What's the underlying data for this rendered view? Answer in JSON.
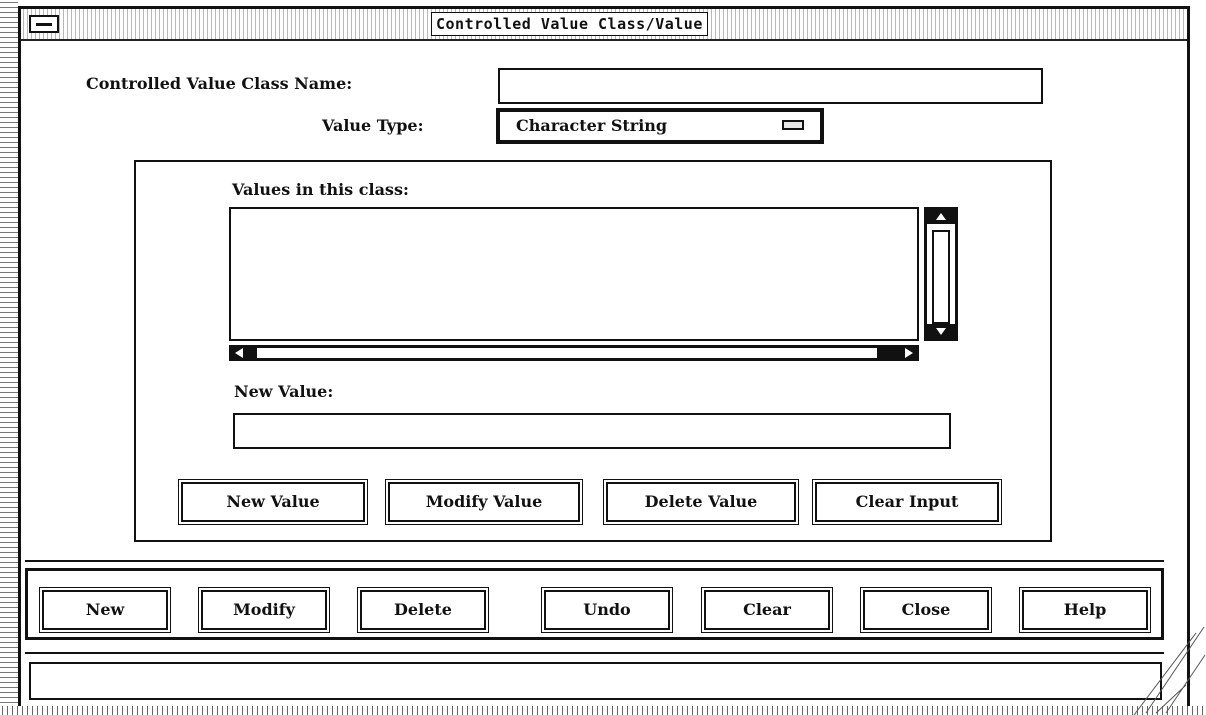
{
  "window": {
    "title": "Controlled Value Class/Value"
  },
  "form": {
    "class_name_label": "Controlled Value Class Name:",
    "class_name_value": "",
    "value_type_label": "Value Type:",
    "value_type_selected": "Character String"
  },
  "values_group": {
    "list_label": "Values in this class:",
    "list_items": [],
    "new_value_label": "New Value:",
    "new_value_value": "",
    "buttons": {
      "new_value": "New Value",
      "modify_value": "Modify Value",
      "delete_value": "Delete Value",
      "clear_input": "Clear Input"
    }
  },
  "actions": {
    "new": "New",
    "modify": "Modify",
    "delete": "Delete",
    "undo": "Undo",
    "clear": "Clear",
    "close": "Close",
    "help": "Help"
  },
  "status": {
    "message": ""
  },
  "icons": {
    "window_menu": "window-menu-icon",
    "option_indicator": "option-menu-indicator-icon",
    "scroll_up": "arrow-up-icon",
    "scroll_down": "arrow-down-icon",
    "scroll_left": "arrow-left-icon",
    "scroll_right": "arrow-right-icon"
  }
}
